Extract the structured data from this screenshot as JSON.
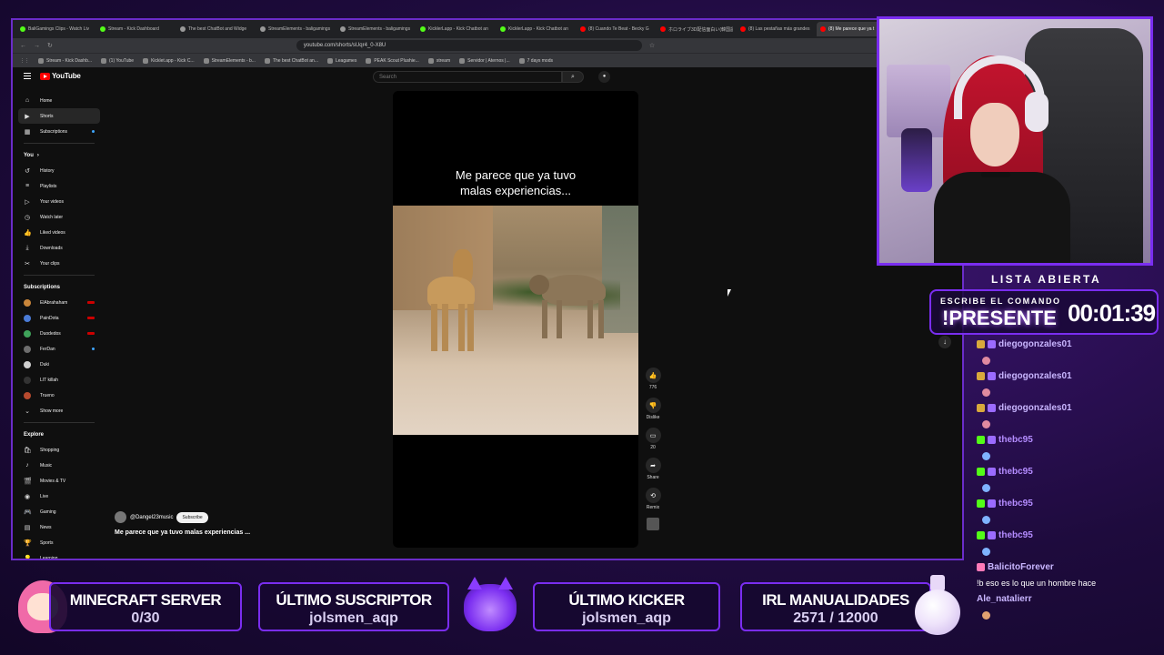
{
  "browser": {
    "tabs": [
      {
        "label": "BaliGamings Clips - Watch Liv",
        "icon": "green"
      },
      {
        "label": "Stream - Kick Dashboard",
        "icon": "green"
      },
      {
        "label": "The best ChatBot and Widge",
        "icon": "grey"
      },
      {
        "label": "StreamElements - baligamings",
        "icon": "grey"
      },
      {
        "label": "StreamElements - baligamings",
        "icon": "grey"
      },
      {
        "label": "KicklerLapp - Kick Chatbot an",
        "icon": "green"
      },
      {
        "label": "KicklerLapp - Kick Chatbot an",
        "icon": "green"
      },
      {
        "label": "(8) Cuando Te Beat - Becky G",
        "icon": "red"
      },
      {
        "label": "ホロライブ3D配信面白い(韓国語",
        "icon": "red"
      },
      {
        "label": "(8) Las pestañas más grandes",
        "icon": "red"
      },
      {
        "label": "(8) Me parece que ya t",
        "icon": "red",
        "active": true
      }
    ],
    "url": "youtube.com/shorts/sUqr4_0-X8U",
    "bookmarks": [
      "Stream - Kick Dashb...",
      "(1) YouTube",
      "Kicklet.app - Kick C...",
      "StreamElements - b...",
      "The best ChatBot an...",
      "Leagames",
      "PEAK Scout Plushie...",
      "stream",
      "Servidor | Aternos |...",
      "7 days mods"
    ]
  },
  "youtube": {
    "logo": "YouTube",
    "search_placeholder": "Search",
    "nav": [
      {
        "label": "Home",
        "icon": "home-icon",
        "glyph": "⌂"
      },
      {
        "label": "Shorts",
        "icon": "shorts-icon",
        "glyph": "▶",
        "active": true
      },
      {
        "label": "Subscriptions",
        "icon": "subscriptions-icon",
        "glyph": "▦",
        "dot": true
      }
    ],
    "you_heading": "You",
    "you_items": [
      {
        "label": "History",
        "icon": "history-icon",
        "glyph": "↺"
      },
      {
        "label": "Playlists",
        "icon": "playlists-icon",
        "glyph": "≡"
      },
      {
        "label": "Your videos",
        "icon": "your-videos-icon",
        "glyph": "▷"
      },
      {
        "label": "Watch later",
        "icon": "watch-later-icon",
        "glyph": "◷"
      },
      {
        "label": "Liked videos",
        "icon": "liked-videos-icon",
        "glyph": "👍"
      },
      {
        "label": "Downloads",
        "icon": "downloads-icon",
        "glyph": "⤓"
      },
      {
        "label": "Your clips",
        "icon": "clips-icon",
        "glyph": "✂"
      }
    ],
    "subs_heading": "Subscriptions",
    "subscriptions": [
      {
        "label": "ElAbrahaham",
        "color": "#c9863a",
        "status": "live"
      },
      {
        "label": "PainDota",
        "color": "#4a7bd6",
        "status": "live"
      },
      {
        "label": "Duodedos",
        "color": "#3fa35a",
        "status": "live"
      },
      {
        "label": "FerDan",
        "color": "#6d6d6d",
        "status": "dot"
      },
      {
        "label": "Duki",
        "color": "#d0d0d0",
        "status": ""
      },
      {
        "label": "LIT killah",
        "color": "#333333",
        "status": ""
      },
      {
        "label": "Trueno",
        "color": "#b74a2e",
        "status": ""
      }
    ],
    "show_more": "Show more",
    "explore_heading": "Explore",
    "explore": [
      {
        "label": "Shopping",
        "icon": "shopping-icon",
        "glyph": "🛍"
      },
      {
        "label": "Music",
        "icon": "music-icon",
        "glyph": "♪"
      },
      {
        "label": "Movies & TV",
        "icon": "movies-icon",
        "glyph": "🎬"
      },
      {
        "label": "Live",
        "icon": "live-icon",
        "glyph": "◉"
      },
      {
        "label": "Gaming",
        "icon": "gaming-icon",
        "glyph": "🎮"
      },
      {
        "label": "News",
        "icon": "news-icon",
        "glyph": "▤"
      },
      {
        "label": "Sports",
        "icon": "sports-icon",
        "glyph": "🏆"
      },
      {
        "label": "Learning",
        "icon": "learning-icon",
        "glyph": "💡"
      }
    ],
    "short": {
      "caption_line1": "Me parece que ya tuvo",
      "caption_line2": "malas experiencias...",
      "channel": "@Dangel23music",
      "subscribe": "Subscribe",
      "title": "Me parece que ya tuvo malas experiencias ..."
    },
    "actions": {
      "like_count": "776",
      "dislike": "Dislike",
      "comments": "20",
      "share": "Share",
      "remix": "Remix"
    }
  },
  "overlay": {
    "lista": "LISTA ABIERTA",
    "command_label": "ESCRIBE EL COMANDO",
    "command": "!PRESENTE",
    "timer": "00:01:39",
    "chat": [
      {
        "user": "diegogonzales01",
        "color": "#c9b6ff",
        "badge": "#d8a93c",
        "emote": "#e08aa0"
      },
      {
        "user": "diegogonzales01",
        "color": "#c9b6ff",
        "badge": "#d8a93c",
        "emote": "#e08aa0"
      },
      {
        "user": "diegogonzales01",
        "color": "#c9b6ff",
        "badge": "#d8a93c",
        "emote": "#e08aa0"
      },
      {
        "user": "thebc95",
        "color": "#b48cff",
        "badge": "#53fc18",
        "emote": "#7fb3ff"
      },
      {
        "user": "thebc95",
        "color": "#b48cff",
        "badge": "#53fc18",
        "emote": "#7fb3ff"
      },
      {
        "user": "thebc95",
        "color": "#b48cff",
        "badge": "#53fc18",
        "emote": "#7fb3ff"
      },
      {
        "user": "thebc95",
        "color": "#b48cff",
        "badge": "#53fc18",
        "emote": "#7fb3ff"
      }
    ],
    "chat_last_user": "BalicitoForever",
    "chat_last_text": "!b eso es lo que un hombre hace",
    "chat_final_user": "Ale_natalierr",
    "widgets": {
      "minecraft_title": "MINECRAFT SERVER",
      "minecraft_value": "0/30",
      "sub_title": "ÚLTIMO SUSCRIPTOR",
      "sub_value": "jolsmen_aqp",
      "kicker_title": "ÚLTIMO KICKER",
      "kicker_value": "jolsmen_aqp",
      "irl_title": "IRL MANUALIDADES",
      "irl_value": "2571 / 12000"
    }
  }
}
